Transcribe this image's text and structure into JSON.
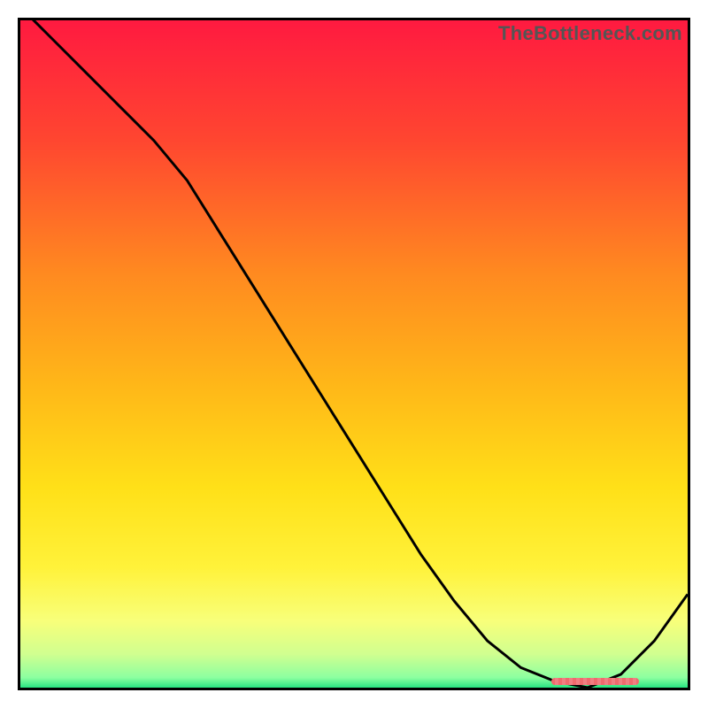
{
  "watermark": "TheBottleneck.com",
  "chart_data": {
    "type": "line",
    "title": "",
    "xlabel": "",
    "ylabel": "",
    "xlim": [
      0,
      100
    ],
    "ylim": [
      0,
      100
    ],
    "series": [
      {
        "name": "curve",
        "x": [
          0,
          5,
          10,
          15,
          20,
          25,
          30,
          35,
          40,
          45,
          50,
          55,
          60,
          65,
          70,
          75,
          80,
          85,
          90,
          95,
          100
        ],
        "values": [
          102,
          97,
          92,
          87,
          82,
          76,
          68,
          60,
          52,
          44,
          36,
          28,
          20,
          13,
          7,
          3,
          1,
          0,
          2,
          7,
          14
        ]
      }
    ],
    "gradient_stops": [
      {
        "offset": 0.0,
        "color": "#ff1a40"
      },
      {
        "offset": 0.18,
        "color": "#ff4630"
      },
      {
        "offset": 0.38,
        "color": "#ff8a20"
      },
      {
        "offset": 0.55,
        "color": "#ffb818"
      },
      {
        "offset": 0.7,
        "color": "#ffe018"
      },
      {
        "offset": 0.82,
        "color": "#fff23a"
      },
      {
        "offset": 0.9,
        "color": "#f8ff7a"
      },
      {
        "offset": 0.95,
        "color": "#d0ff90"
      },
      {
        "offset": 0.985,
        "color": "#8cffa0"
      },
      {
        "offset": 1.0,
        "color": "#28e482"
      }
    ],
    "blob": {
      "x_start": 79,
      "x_end": 92
    }
  }
}
